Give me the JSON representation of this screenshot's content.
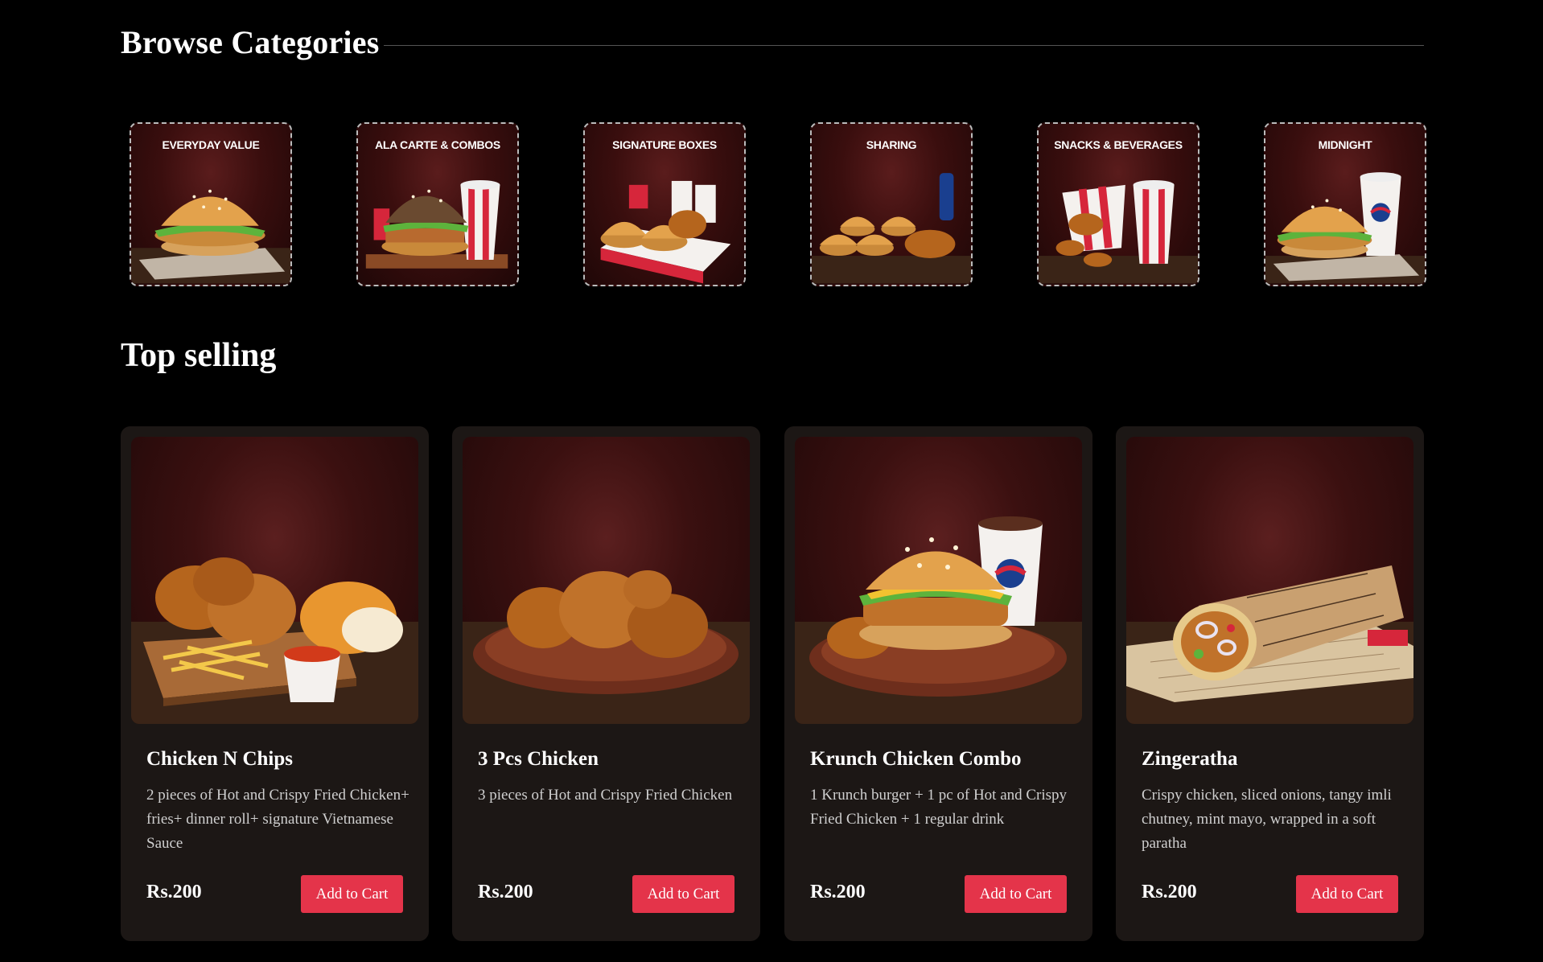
{
  "browse": {
    "title": "Browse Categories",
    "categories": [
      {
        "label": "EVERYDAY VALUE",
        "icon": "burger-icon"
      },
      {
        "label": "ALA CARTE & COMBOS",
        "icon": "burger-drink-icon"
      },
      {
        "label": "SIGNATURE BOXES",
        "icon": "box-meal-icon"
      },
      {
        "label": "SHARING",
        "icon": "sharing-platter-icon"
      },
      {
        "label": "SNACKS & BEVERAGES",
        "icon": "bucket-drink-icon"
      },
      {
        "label": "MIDNIGHT",
        "icon": "burger-drink-icon"
      }
    ]
  },
  "top_selling": {
    "title": "Top selling",
    "products": [
      {
        "name": "Chicken N Chips",
        "description": "2 pieces of Hot and Crispy Fried Chicken+ fries+ dinner roll+ signature Vietnamese Sauce",
        "price": "Rs.200",
        "button": "Add to Cart",
        "image": "chicken-chips-platter"
      },
      {
        "name": "3 Pcs Chicken",
        "description": "3 pieces of Hot and Crispy Fried Chicken",
        "price": "Rs.200",
        "button": "Add to Cart",
        "image": "fried-chicken-plate"
      },
      {
        "name": "Krunch Chicken Combo",
        "description": "1 Krunch burger + 1 pc of Hot and Crispy Fried Chicken + 1 regular drink",
        "price": "Rs.200",
        "button": "Add to Cart",
        "image": "burger-combo-plate"
      },
      {
        "name": "Zingeratha",
        "description": "Crispy chicken, sliced onions, tangy imli chutney, mint mayo, wrapped in a soft paratha",
        "price": "Rs.200",
        "button": "Add to Cart",
        "image": "wrap-paratha"
      }
    ]
  },
  "colors": {
    "background": "#000000",
    "card": "#1c1715",
    "accent_button": "#e4344a",
    "text_muted": "#cfcfcf"
  }
}
